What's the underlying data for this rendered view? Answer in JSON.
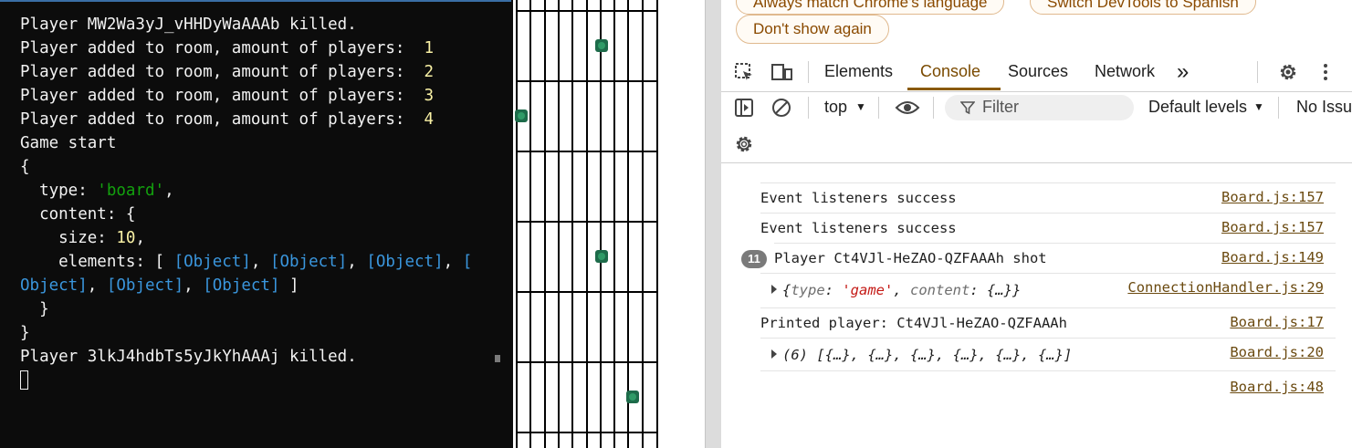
{
  "terminal": {
    "line1": "Player MW2Wa3yJ_vHHDyWaAAAb killed.",
    "added_text": "Player added to room, amount of players:  ",
    "counts": [
      "1",
      "2",
      "3",
      "4"
    ],
    "game_start": "Game start",
    "brace_open": "{",
    "type_key": "  type: ",
    "type_value": "'board'",
    "comma": ",",
    "content_key": "  content: {",
    "size_key": "    size: ",
    "size_value": "10",
    "elements_key": "    elements: [ ",
    "obj_a": "[Object]",
    "obj_split_a": "[",
    "obj_split_b": "Object]",
    "sep": ", ",
    "elements_close": " ]",
    "inner_close": "  }",
    "brace_close": "}",
    "killed_line": "Player 3lkJ4hdbTs5yJkYhAAAj killed."
  },
  "devtools": {
    "lang_buttons": [
      "Always match Chrome's language",
      "Switch DevTools to Spanish"
    ],
    "dont_show": "Don't show again",
    "tabs": [
      "Elements",
      "Console",
      "Sources",
      "Network"
    ],
    "active_tab": "Console",
    "more_tabs": "»",
    "context": "top",
    "filter_placeholder": "Filter",
    "levels": "Default levels",
    "issues": "No Issues",
    "logs": [
      {
        "msg": "Event listeners success",
        "src": "Board.js:157"
      },
      {
        "msg": "Event listeners success",
        "src": "Board.js:157"
      },
      {
        "count": "11",
        "msg": "Player Ct4VJl-HeZAO-QZFAAAh shot",
        "src": "Board.js:149"
      },
      {
        "obj_open": "{",
        "key1": "type",
        "colon": ": ",
        "val1": "'game'",
        "comma": ", ",
        "key2": "content",
        "val2": "{…}",
        "obj_close": "}",
        "src": "ConnectionHandler.js:29"
      },
      {
        "msg": "Printed player: Ct4VJl-HeZAO-QZFAAAh",
        "src": "Board.js:17"
      },
      {
        "msg": "(6) [{…}, {…}, {…}, {…}, {…}, {…}]",
        "src": "Board.js:20"
      },
      {
        "msg": "",
        "src": "Board.js:48"
      }
    ]
  },
  "colors": {
    "terminal_bg": "#0c0c0c",
    "terminal_number": "#f9f1a5",
    "terminal_string": "#13a10e",
    "terminal_object": "#3a96dd",
    "devtools_accent": "#8a5a00",
    "tank": "#1d6b4a"
  }
}
